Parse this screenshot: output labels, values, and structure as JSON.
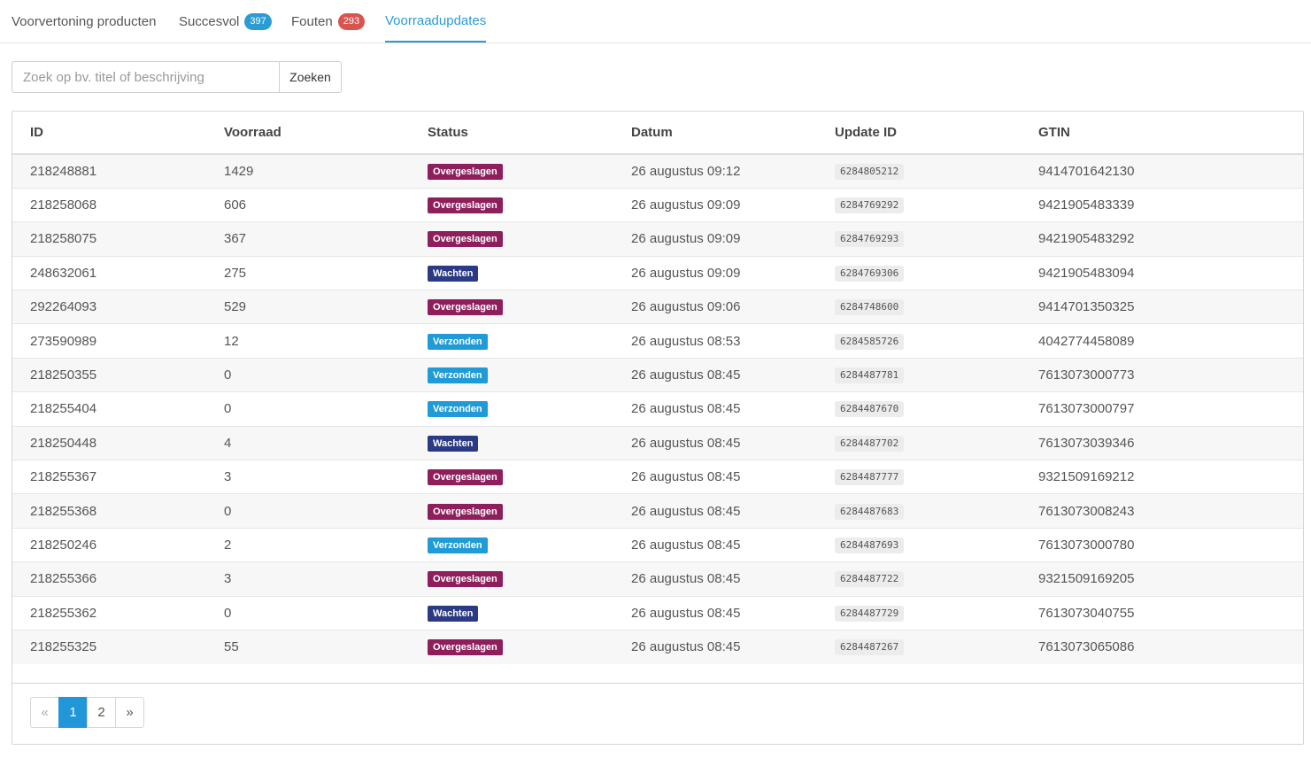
{
  "tabs": [
    {
      "label": "Voorvertoning producten"
    },
    {
      "label": "Succesvol",
      "badge": "397"
    },
    {
      "label": "Fouten",
      "badge": "293"
    },
    {
      "label": "Voorraadupdates"
    }
  ],
  "search": {
    "placeholder": "Zoek op bv. titel of beschrijving",
    "value": "",
    "button_label": "Zoeken"
  },
  "table": {
    "columns": [
      "ID",
      "Voorraad",
      "Status",
      "Datum",
      "Update ID",
      "GTIN"
    ],
    "rows": [
      {
        "id": "218248881",
        "stock": "1429",
        "status": "Overgeslagen",
        "date": "26 augustus 09:12",
        "update_id": "6284805212",
        "gtin": "9414701642130"
      },
      {
        "id": "218258068",
        "stock": "606",
        "status": "Overgeslagen",
        "date": "26 augustus 09:09",
        "update_id": "6284769292",
        "gtin": "9421905483339"
      },
      {
        "id": "218258075",
        "stock": "367",
        "status": "Overgeslagen",
        "date": "26 augustus 09:09",
        "update_id": "6284769293",
        "gtin": "9421905483292"
      },
      {
        "id": "248632061",
        "stock": "275",
        "status": "Wachten",
        "date": "26 augustus 09:09",
        "update_id": "6284769306",
        "gtin": "9421905483094"
      },
      {
        "id": "292264093",
        "stock": "529",
        "status": "Overgeslagen",
        "date": "26 augustus 09:06",
        "update_id": "6284748600",
        "gtin": "9414701350325"
      },
      {
        "id": "273590989",
        "stock": "12",
        "status": "Verzonden",
        "date": "26 augustus 08:53",
        "update_id": "6284585726",
        "gtin": "4042774458089"
      },
      {
        "id": "218250355",
        "stock": "0",
        "status": "Verzonden",
        "date": "26 augustus 08:45",
        "update_id": "6284487781",
        "gtin": "7613073000773"
      },
      {
        "id": "218255404",
        "stock": "0",
        "status": "Verzonden",
        "date": "26 augustus 08:45",
        "update_id": "6284487670",
        "gtin": "7613073000797"
      },
      {
        "id": "218250448",
        "stock": "4",
        "status": "Wachten",
        "date": "26 augustus 08:45",
        "update_id": "6284487702",
        "gtin": "7613073039346"
      },
      {
        "id": "218255367",
        "stock": "3",
        "status": "Overgeslagen",
        "date": "26 augustus 08:45",
        "update_id": "6284487777",
        "gtin": "9321509169212"
      },
      {
        "id": "218255368",
        "stock": "0",
        "status": "Overgeslagen",
        "date": "26 augustus 08:45",
        "update_id": "6284487683",
        "gtin": "7613073008243"
      },
      {
        "id": "218250246",
        "stock": "2",
        "status": "Verzonden",
        "date": "26 augustus 08:45",
        "update_id": "6284487693",
        "gtin": "7613073000780"
      },
      {
        "id": "218255366",
        "stock": "3",
        "status": "Overgeslagen",
        "date": "26 augustus 08:45",
        "update_id": "6284487722",
        "gtin": "9321509169205"
      },
      {
        "id": "218255362",
        "stock": "0",
        "status": "Wachten",
        "date": "26 augustus 08:45",
        "update_id": "6284487729",
        "gtin": "7613073040755"
      },
      {
        "id": "218255325",
        "stock": "55",
        "status": "Overgeslagen",
        "date": "26 augustus 08:45",
        "update_id": "6284487267",
        "gtin": "7613073065086"
      }
    ]
  },
  "status_colors": {
    "Overgeslagen": "#8e1f5c",
    "Wachten": "#2b3a84",
    "Verzonden": "#1f9bd7"
  },
  "pagination": {
    "prev": "«",
    "pages": [
      "1",
      "2"
    ],
    "current": "1",
    "next": "»"
  },
  "colors": {
    "accent": "#2b9bd6",
    "badge_success": "#2b9bd6",
    "badge_error": "#d9534f"
  }
}
